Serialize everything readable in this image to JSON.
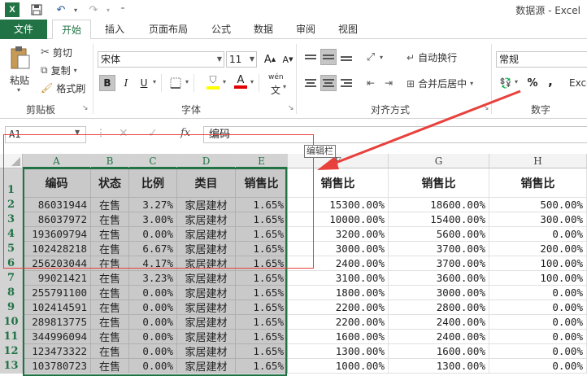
{
  "app": {
    "window_title": "数据源 - Excel"
  },
  "tabs": [
    "文件",
    "开始",
    "插入",
    "页面布局",
    "公式",
    "数据",
    "审阅",
    "视图"
  ],
  "ribbon": {
    "clipboard": {
      "paste": "粘贴",
      "cut": "剪切",
      "copy": "复制",
      "format_painter": "格式刷",
      "label": "剪贴板"
    },
    "font": {
      "name": "宋体",
      "size": "11",
      "label": "字体",
      "bold": "B",
      "italic": "I",
      "underline": "U",
      "color_letter": "A",
      "phonetic": "wén"
    },
    "alignment": {
      "wrap": "自动换行",
      "merge": "合并后居中",
      "label": "对齐方式"
    },
    "number": {
      "format": "常规",
      "label": "数字",
      "percent": "%",
      "comma": ",",
      "extra": "Exce"
    }
  },
  "formula_bar": {
    "name_box": "A1",
    "fx": "fx",
    "value": "编码",
    "tooltip": "编辑栏"
  },
  "sheet": {
    "columns": [
      "A",
      "B",
      "C",
      "D",
      "E",
      "F",
      "G",
      "H"
    ],
    "header_row": [
      "编码",
      "状态",
      "比例",
      "类目",
      "销售比",
      "销售比",
      "销售比",
      "销售比"
    ],
    "rows": [
      [
        "86031944",
        "在售",
        "3.27%",
        "家居建材",
        "1.65%",
        "15300.00%",
        "18600.00%",
        "500.00%"
      ],
      [
        "86037972",
        "在售",
        "3.00%",
        "家居建材",
        "1.65%",
        "10000.00%",
        "15400.00%",
        "300.00%"
      ],
      [
        "193609794",
        "在售",
        "0.00%",
        "家居建材",
        "1.65%",
        "3200.00%",
        "5600.00%",
        "0.00%"
      ],
      [
        "102428218",
        "在售",
        "6.67%",
        "家居建材",
        "1.65%",
        "3000.00%",
        "3700.00%",
        "200.00%"
      ],
      [
        "256203044",
        "在售",
        "4.17%",
        "家居建材",
        "1.65%",
        "2400.00%",
        "3700.00%",
        "100.00%"
      ],
      [
        "99021421",
        "在售",
        "3.23%",
        "家居建材",
        "1.65%",
        "3100.00%",
        "3600.00%",
        "100.00%"
      ],
      [
        "255791100",
        "在售",
        "0.00%",
        "家居建材",
        "1.65%",
        "1800.00%",
        "3000.00%",
        "0.00%"
      ],
      [
        "102414591",
        "在售",
        "0.00%",
        "家居建材",
        "1.65%",
        "2200.00%",
        "2800.00%",
        "0.00%"
      ],
      [
        "289813775",
        "在售",
        "0.00%",
        "家居建材",
        "1.65%",
        "2200.00%",
        "2400.00%",
        "0.00%"
      ],
      [
        "344996094",
        "在售",
        "0.00%",
        "家居建材",
        "1.65%",
        "1600.00%",
        "2400.00%",
        "0.00%"
      ],
      [
        "123473322",
        "在售",
        "0.00%",
        "家居建材",
        "1.65%",
        "1300.00%",
        "1600.00%",
        "0.00%"
      ],
      [
        "103780723",
        "在售",
        "0.00%",
        "家居建材",
        "1.65%",
        "1000.00%",
        "1300.00%",
        "0.00%"
      ]
    ],
    "row_numbers": [
      "1",
      "2",
      "3",
      "4",
      "5",
      "6",
      "7",
      "8",
      "9",
      "10",
      "11",
      "12",
      "13"
    ]
  },
  "colors": {
    "accent": "#217346",
    "annotation": "#e8413c"
  }
}
